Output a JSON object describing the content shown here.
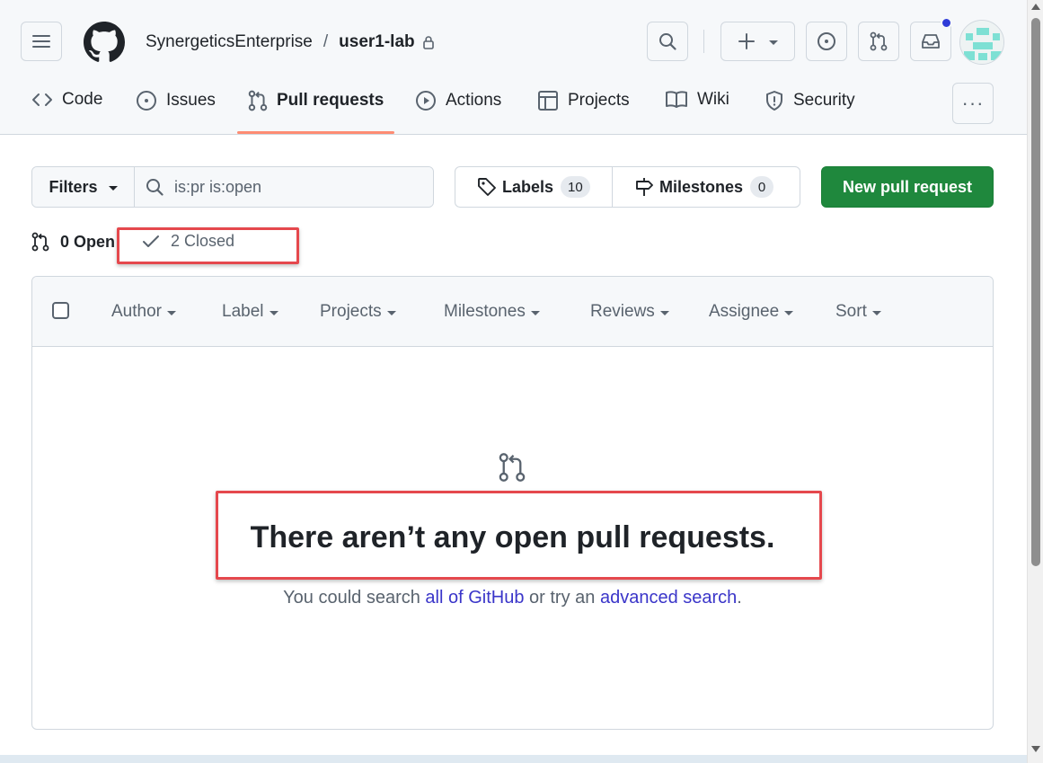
{
  "header": {
    "owner": "SynergeticsEnterprise",
    "separator": "/",
    "repo": "user1-lab",
    "icons": [
      "hamburger-menu-icon",
      "github-mark-icon",
      "lock-icon",
      "search-icon",
      "plus-icon",
      "chevron-down-icon",
      "issue-opened-icon",
      "git-pull-request-icon",
      "inbox-icon",
      "avatar"
    ],
    "notification_dot_color": "#2f3cd8"
  },
  "tabs": [
    {
      "label": "Code",
      "icon": "code-icon"
    },
    {
      "label": "Issues",
      "icon": "issue-opened-icon"
    },
    {
      "label": "Pull requests",
      "icon": "git-pull-request-icon",
      "active": true
    },
    {
      "label": "Actions",
      "icon": "play-icon"
    },
    {
      "label": "Projects",
      "icon": "table-icon"
    },
    {
      "label": "Wiki",
      "icon": "book-icon"
    },
    {
      "label": "Security",
      "icon": "shield-icon"
    }
  ],
  "more_label": "···",
  "filters": {
    "button_label": "Filters",
    "search_value": "is:pr is:open"
  },
  "labels": {
    "label": "Labels",
    "count": "10"
  },
  "milestones": {
    "label": "Milestones",
    "count": "0"
  },
  "new_pr_label": "New pull request",
  "state": {
    "open_label": "0 Open",
    "closed_label": "2 Closed"
  },
  "columns": [
    "Author",
    "Label",
    "Projects",
    "Milestones",
    "Reviews",
    "Assignee",
    "Sort"
  ],
  "empty": {
    "title": "There aren’t any open pull requests.",
    "sub_prefix": "You could search ",
    "link1": "all of GitHub",
    "sub_mid": " or try an ",
    "link2": "advanced search",
    "sub_suffix": "."
  },
  "colors": {
    "accent_underline": "#fd8c73",
    "primary_button": "#1f883d",
    "link": "#3a35c9",
    "highlight": "#e5484d"
  }
}
